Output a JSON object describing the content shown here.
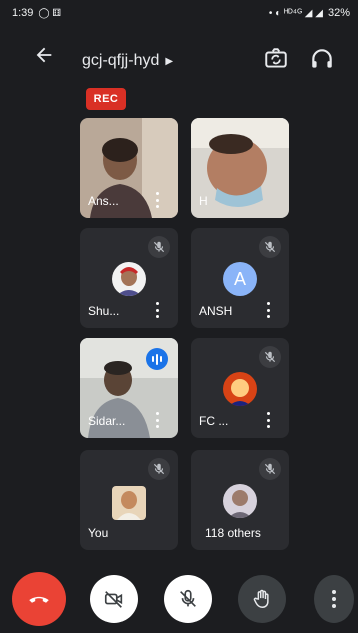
{
  "status": {
    "time": "1:39",
    "left_icons": "◯ ⚅",
    "right_icons": "• ◐ ᴴᴰ⁴ᴳ ◢ ◢",
    "battery": "32%"
  },
  "header": {
    "meeting_code": "gcj-qfjj-hyd",
    "rec_label": "REC"
  },
  "participants": [
    {
      "name": "Ans...",
      "has_more": true
    },
    {
      "name": "H",
      "has_more": false
    },
    {
      "name": "Shu...",
      "has_more": true
    },
    {
      "name": "ANSH",
      "avatar_letter": "A",
      "has_more": true
    },
    {
      "name": "Sidar...",
      "has_more": true
    },
    {
      "name": "FC ...",
      "has_more": true
    },
    {
      "name": "You",
      "has_more": false
    },
    {
      "name": "118 others",
      "has_more": false
    }
  ],
  "colors": {
    "background": "#1c1d20",
    "tile": "#2b2c30",
    "rec": "#d93025",
    "end_call": "#ea4335",
    "speaking": "#1a73e8",
    "avatar_ansh": "#8ab4f8"
  },
  "icons": {
    "back": "back-arrow-icon",
    "switch_camera": "switch-camera-icon",
    "audio": "headphones-icon",
    "end_call": "end-call-icon",
    "camera_off": "camera-off-icon",
    "mic_off": "mic-off-icon",
    "raise_hand": "raise-hand-icon",
    "more": "more-vert-icon"
  }
}
